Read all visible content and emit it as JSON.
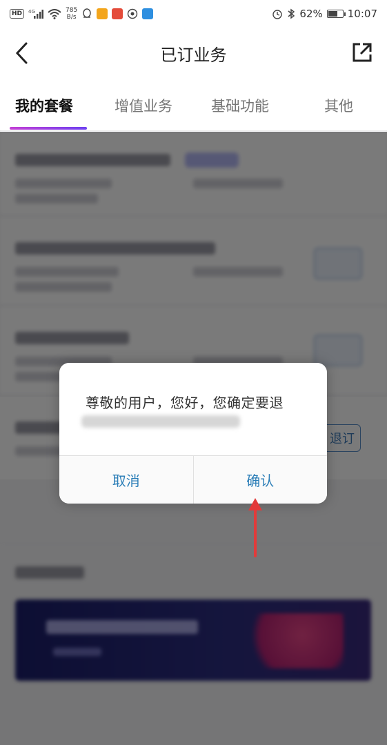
{
  "status_bar": {
    "hd": "HD",
    "net_type": "4G",
    "speed_value": "785",
    "speed_unit": "B/s",
    "battery": "62%",
    "time": "10:07"
  },
  "header": {
    "title": "已订业务"
  },
  "tabs": [
    {
      "label": "我的套餐"
    },
    {
      "label": "增值业务"
    },
    {
      "label": "基础功能"
    },
    {
      "label": "其他"
    }
  ],
  "content": {
    "partial_button_label": "退订"
  },
  "dialog": {
    "message": "尊敬的用户，您好，您确定要退",
    "cancel_label": "取消",
    "confirm_label": "确认"
  },
  "colors": {
    "accent_purple": "#c23bd4",
    "accent_violet": "#6a3cf0",
    "dialog_button_blue": "#2d7fb8",
    "annotation_red": "#e23a3a"
  }
}
